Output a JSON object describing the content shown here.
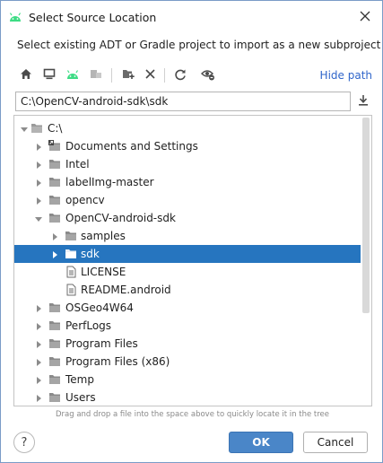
{
  "window": {
    "title": "Select Source Location",
    "close_icon": "close-icon"
  },
  "description": "Select existing ADT or Gradle project to import as a new subproject",
  "toolbar": {
    "buttons": [
      "home-icon",
      "desktop-icon",
      "android-icon",
      "project-icon",
      "new-folder-icon",
      "delete-icon",
      "refresh-icon",
      "show-hidden-icon"
    ],
    "hide_path_label": "Hide path"
  },
  "path": {
    "value": "C:\\OpenCV-android-sdk\\sdk",
    "download_icon": "download-icon"
  },
  "tree": {
    "items": [
      {
        "label": "C:\\",
        "type": "drive",
        "expanded": true,
        "level": 0
      },
      {
        "label": "Documents and Settings",
        "type": "folder-link",
        "expanded": false,
        "level": 1
      },
      {
        "label": "Intel",
        "type": "folder",
        "expanded": false,
        "level": 1
      },
      {
        "label": "labelImg-master",
        "type": "folder",
        "expanded": false,
        "level": 1
      },
      {
        "label": "opencv",
        "type": "folder",
        "expanded": false,
        "level": 1
      },
      {
        "label": "OpenCV-android-sdk",
        "type": "folder",
        "expanded": true,
        "level": 1
      },
      {
        "label": "samples",
        "type": "folder",
        "expanded": false,
        "level": 2
      },
      {
        "label": "sdk",
        "type": "folder",
        "expanded": false,
        "level": 2,
        "selected": true
      },
      {
        "label": "LICENSE",
        "type": "file",
        "level": 2
      },
      {
        "label": "README.android",
        "type": "file",
        "level": 2
      },
      {
        "label": "OSGeo4W64",
        "type": "folder",
        "expanded": false,
        "level": 1
      },
      {
        "label": "PerfLogs",
        "type": "folder",
        "expanded": false,
        "level": 1
      },
      {
        "label": "Program Files",
        "type": "folder",
        "expanded": false,
        "level": 1
      },
      {
        "label": "Program Files (x86)",
        "type": "folder",
        "expanded": false,
        "level": 1
      },
      {
        "label": "Temp",
        "type": "folder",
        "expanded": false,
        "level": 1
      },
      {
        "label": "Users",
        "type": "folder",
        "expanded": false,
        "level": 1
      }
    ]
  },
  "hint": "Drag and drop a file into the space above to quickly locate it in the tree",
  "footer": {
    "help_label": "?",
    "ok_label": "OK",
    "cancel_label": "Cancel"
  },
  "colors": {
    "selection": "#2675bf",
    "link": "#2f65ca",
    "ok_button": "#4a86c8",
    "android_green": "#3ddc84"
  }
}
